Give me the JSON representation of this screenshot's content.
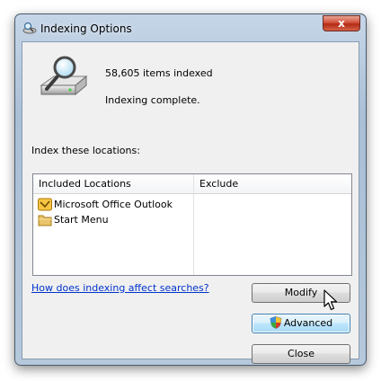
{
  "window": {
    "title": "Indexing Options",
    "close_label": "x"
  },
  "status": {
    "items_indexed": "58,605 items indexed",
    "state": "Indexing complete."
  },
  "locations": {
    "label": "Index these locations:",
    "columns": [
      "Included Locations",
      "Exclude"
    ],
    "rows": [
      {
        "name": "Microsoft Office Outlook",
        "icon": "outlook-icon",
        "exclude": ""
      },
      {
        "name": "Start Menu",
        "icon": "folder-icon",
        "exclude": ""
      }
    ]
  },
  "help_link": "How does indexing affect searches?",
  "buttons": {
    "modify": "Modify",
    "advanced": "Advanced",
    "close": "Close"
  }
}
